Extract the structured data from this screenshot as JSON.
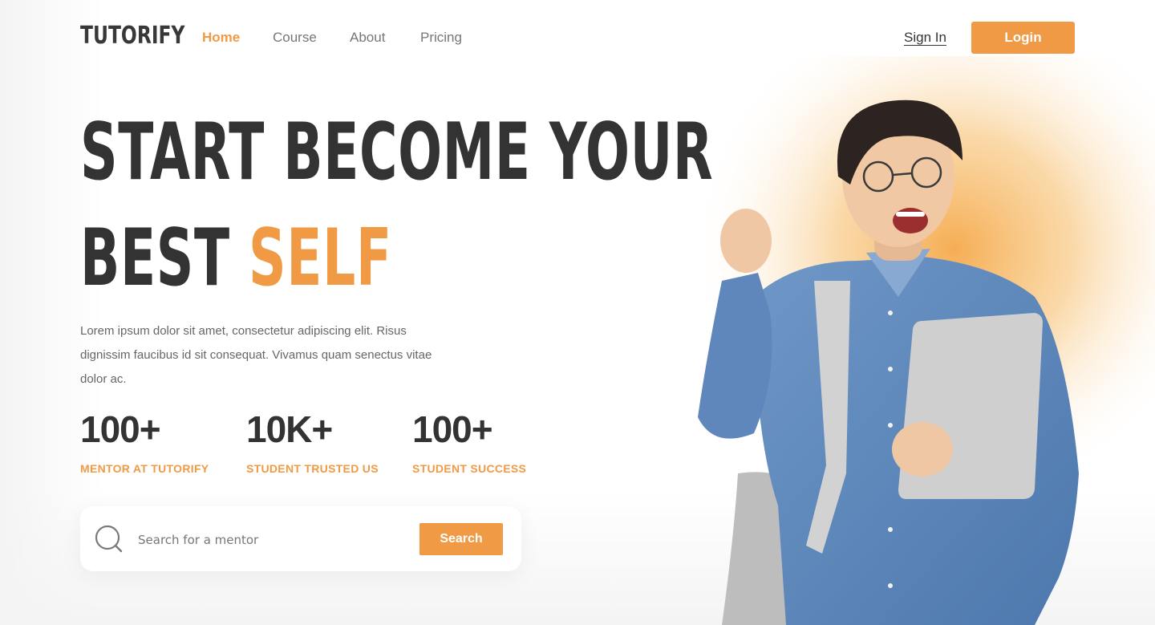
{
  "header": {
    "logo": "TUTORIFY",
    "nav": [
      {
        "label": "Home",
        "active": true
      },
      {
        "label": "Course",
        "active": false
      },
      {
        "label": "About",
        "active": false
      },
      {
        "label": "Pricing",
        "active": false
      }
    ],
    "sign_in": "Sign In",
    "login": "Login"
  },
  "hero": {
    "headline_line1": "START BECOME YOUR",
    "headline_line2_plain": "BEST",
    "headline_line2_accent": "SELF",
    "description": "Lorem ipsum dolor sit amet, consectetur adipiscing elit. Risus dignissim faucibus id sit consequat. Vivamus quam senectus vitae dolor ac.",
    "image_icon": "student-celebrating-illustration"
  },
  "stats": [
    {
      "value": "100+",
      "label": "MENTOR AT TUTORIFY"
    },
    {
      "value": "10K+",
      "label": "STUDENT TRUSTED US"
    },
    {
      "value": "100+",
      "label": "STUDENT SUCCESS"
    }
  ],
  "search": {
    "placeholder": "Search for a mentor",
    "value": "",
    "button": "Search",
    "icon": "search-icon"
  },
  "colors": {
    "accent": "#f19a45",
    "text_dark": "#333333",
    "text_muted": "#666666"
  }
}
